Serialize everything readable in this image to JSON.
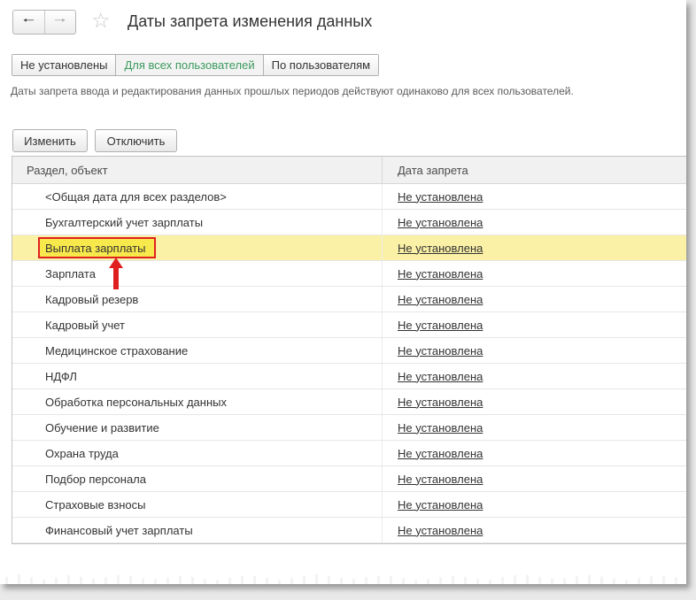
{
  "window": {
    "title": "Даты запрета изменения данных"
  },
  "nav": {
    "back_icon": "arrow-left",
    "forward_icon": "arrow-right",
    "favorite_icon": "star"
  },
  "tabs": [
    {
      "label": "Не установлены",
      "active": false
    },
    {
      "label": "Для всех пользователей",
      "active": true
    },
    {
      "label": "По пользователям",
      "active": false
    }
  ],
  "description": "Даты запрета ввода и редактирования данных прошлых периодов действуют одинаково для всех пользователей.",
  "toolbar": {
    "edit_label": "Изменить",
    "disable_label": "Отключить"
  },
  "table": {
    "columns": [
      "Раздел, объект",
      "Дата запрета"
    ],
    "rows": [
      {
        "section": "<Общая дата для всех разделов>",
        "date": "Не установлена"
      },
      {
        "section": "Бухгалтерский учет зарплаты",
        "date": "Не установлена"
      },
      {
        "section": "Выплата зарплаты",
        "date": "Не установлена",
        "selected": true
      },
      {
        "section": "Зарплата",
        "date": "Не установлена"
      },
      {
        "section": "Кадровый резерв",
        "date": "Не установлена"
      },
      {
        "section": "Кадровый учет",
        "date": "Не установлена"
      },
      {
        "section": "Медицинское страхование",
        "date": "Не установлена"
      },
      {
        "section": "НДФЛ",
        "date": "Не установлена"
      },
      {
        "section": "Обработка персональных данных",
        "date": "Не установлена"
      },
      {
        "section": "Обучение и развитие",
        "date": "Не установлена"
      },
      {
        "section": "Охрана труда",
        "date": "Не установлена"
      },
      {
        "section": "Подбор персонала",
        "date": "Не установлена"
      },
      {
        "section": "Страховые взносы",
        "date": "Не установлена"
      },
      {
        "section": "Финансовый учет зарплаты",
        "date": "Не установлена"
      }
    ]
  },
  "colors": {
    "selected_row": "#faf0a6",
    "highlight_border": "#e02020",
    "active_tab_text": "#3c9a5f"
  }
}
